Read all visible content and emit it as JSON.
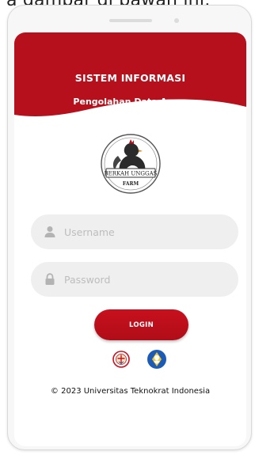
{
  "caption": "a gambar di bawah ini:",
  "header": {
    "title": "SISTEM INFORMASI",
    "subtitle": "Pengolahan Data Ayam",
    "color": "#b5101b"
  },
  "logo": {
    "icon": "berkah-unggas-farm-logo",
    "line1": "BERKAH UNGGAS",
    "line2": "FARM"
  },
  "form": {
    "username": {
      "placeholder": "Username",
      "value": "",
      "icon": "user-icon"
    },
    "password": {
      "placeholder": "Password",
      "value": "",
      "icon": "lock-icon"
    },
    "login_label": "LOGIN"
  },
  "emblems": [
    {
      "icon": "university-emblem-icon"
    },
    {
      "icon": "tut-wuri-handayani-emblem-icon"
    }
  ],
  "footer": {
    "copyright": "© 2023 Universitas Teknokrat Indonesia"
  }
}
